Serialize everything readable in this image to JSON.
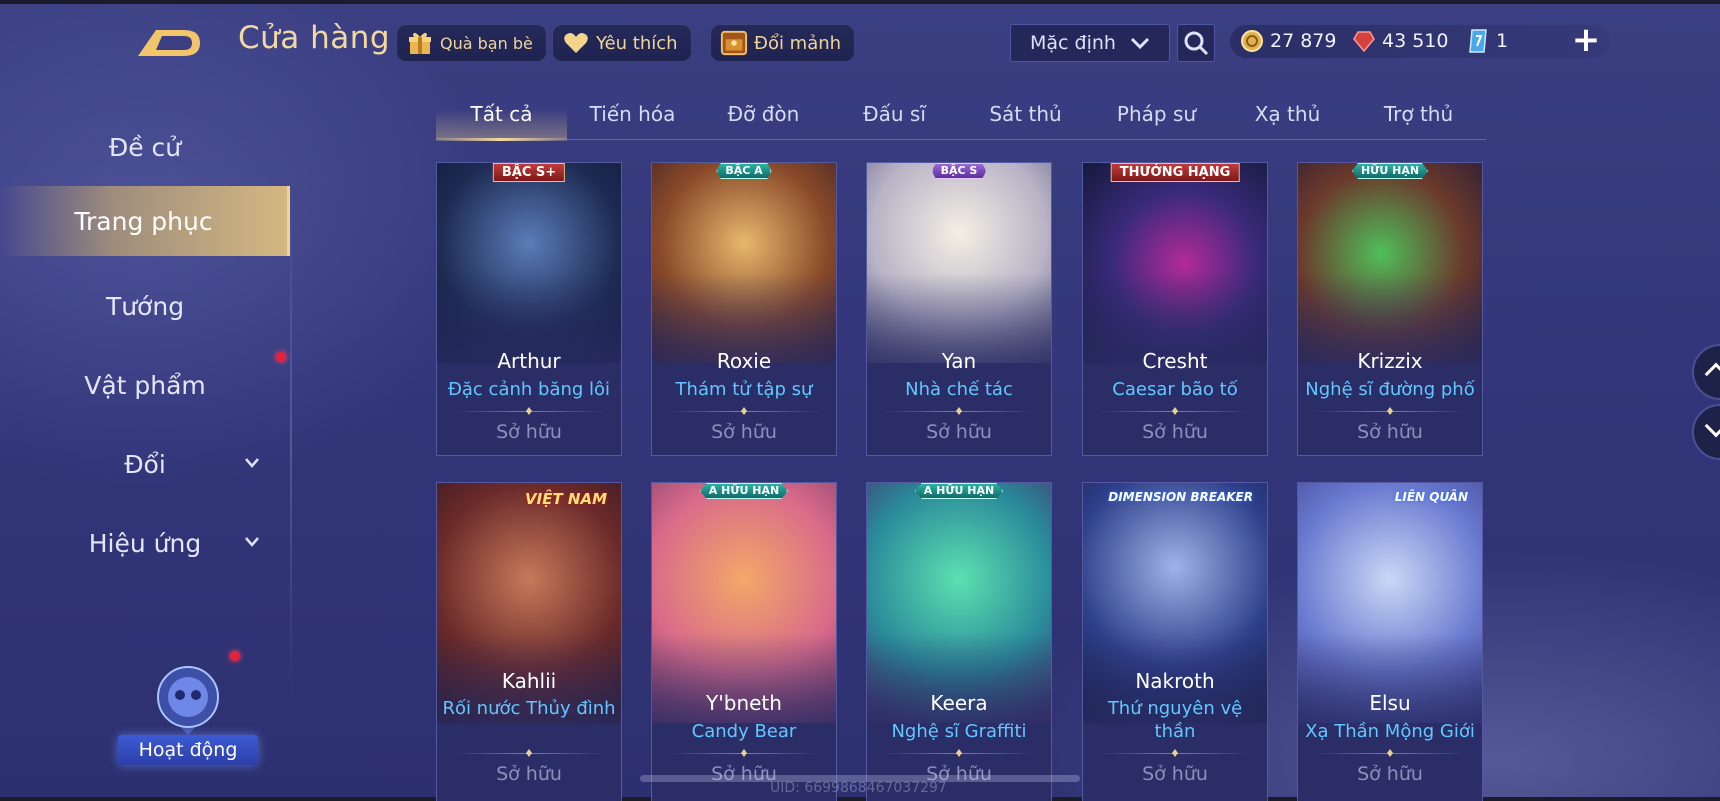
{
  "header": {
    "title": "Cửa hàng",
    "gift_label": "Quà bạn bè",
    "favorite_label": "Yêu thích",
    "exchange_label": "Đổi mảnh",
    "sort_value": "Mặc định"
  },
  "currency": {
    "gold": "27 879",
    "gems": "43 510",
    "tickets": "1"
  },
  "sidebar": {
    "items": [
      {
        "label": "Đề cử"
      },
      {
        "label": "Trang phục"
      },
      {
        "label": "Tướng"
      },
      {
        "label": "Vật phẩm"
      },
      {
        "label": "Đổi"
      },
      {
        "label": "Hiệu ứng"
      }
    ],
    "event_label": "Hoạt động"
  },
  "tabs": [
    "Tất cả",
    "Tiến hóa",
    "Đỡ đòn",
    "Đấu sĩ",
    "Sát thủ",
    "Pháp sư",
    "Xạ thủ",
    "Trợ thủ"
  ],
  "cards": [
    {
      "name": "Arthur",
      "skin": "Đặc cảnh băng lôi",
      "status": "Sở hữu",
      "badge": "BẬC S+"
    },
    {
      "name": "Roxie",
      "skin": "Thám tử tập sự",
      "status": "Sở hữu",
      "badge": "BẬC A"
    },
    {
      "name": "Yan",
      "skin": "Nhà chế tác",
      "status": "Sở hữu",
      "badge": "BẬC S"
    },
    {
      "name": "Cresht",
      "skin": "Caesar bão tố",
      "status": "Sở hữu",
      "badge": "THƯỞNG HẠNG"
    },
    {
      "name": "Krizzix",
      "skin": "Nghệ sĩ đường phố",
      "status": "Sở hữu",
      "badge": "HỮU HẠN"
    },
    {
      "name": "Kahlii",
      "skin": "Rối nước Thủy đình",
      "status": "Sở hữu",
      "badge": "VIỆT NAM"
    },
    {
      "name": "Y'bneth",
      "skin": "Candy Bear",
      "status": "Sở hữu",
      "badge": "A HỮU HẠN"
    },
    {
      "name": "Keera",
      "skin": "Nghệ sĩ Graffiti",
      "status": "Sở hữu",
      "badge": "A HỮU HẠN"
    },
    {
      "name": "Nakroth",
      "skin": "Thứ nguyên vệ thần",
      "status": "Sở hữu",
      "badge": "DIMENSION BREAKER"
    },
    {
      "name": "Elsu",
      "skin": "Xạ Thần Mộng Giới",
      "status": "Sở hữu",
      "badge": "LIÊN QUÂN"
    }
  ],
  "uid": "UID: 6699868467037297",
  "colors": {
    "accent_gold": "#f3d9a1",
    "skin_name_blue": "#63c7ff",
    "notification_red": "#e8203a"
  }
}
